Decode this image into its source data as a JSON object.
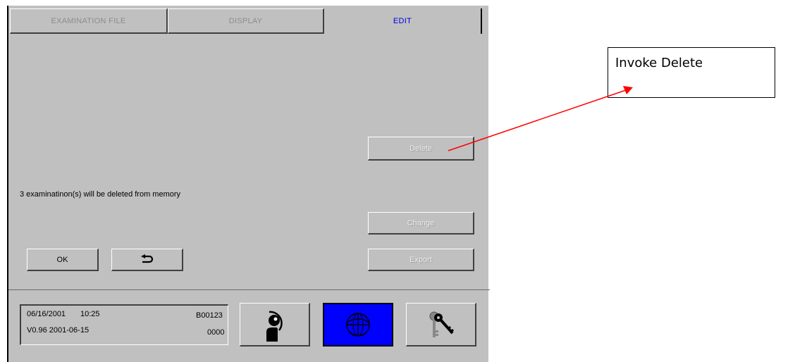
{
  "tabs": [
    "EXAMINATION FILE",
    "DISPLAY",
    "EDIT"
  ],
  "active_tab": "EDIT",
  "buttons": {
    "delete": "Delete",
    "change": "Change",
    "export": "Export",
    "ok": "OK",
    "back_icon": "undo-arrow-icon"
  },
  "message": "3 examinatinon(s) will be deleted from memory",
  "status": {
    "date": "06/16/2001",
    "time": "10:25",
    "device_id": "B00123",
    "version": "V0.96  2001-06-15",
    "counter": "0000"
  },
  "bottom_icons": [
    "patient-icon",
    "eye-globe-icon",
    "keys-icon"
  ],
  "colors": {
    "panel": "#c0c0c0",
    "active_tab_text": "#0000e0",
    "selected_button": "#0000ff",
    "arrow": "#ff0000"
  },
  "annotation": {
    "text": "Invoke Delete"
  }
}
